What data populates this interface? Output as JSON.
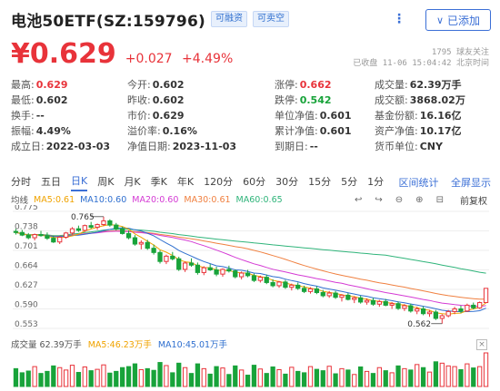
{
  "header": {
    "title": "电池50ETF(SZ:159796)",
    "badges": [
      "可融资",
      "可卖空"
    ],
    "more_icon": "more-dots-icon",
    "added_label": "已添加"
  },
  "quote": {
    "price": "¥0.629",
    "change": "+0.027",
    "change_pct": "+4.49%",
    "followers": "1795 球友关注",
    "status": "已收盘 11-06 15:04:42 北京时间"
  },
  "stats": [
    {
      "label": "最高:",
      "value": "0.629",
      "color": "red"
    },
    {
      "label": "今开:",
      "value": "0.602",
      "color": ""
    },
    {
      "label": "涨停:",
      "value": "0.662",
      "color": "red"
    },
    {
      "label": "成交量:",
      "value": "62.39万手",
      "color": ""
    },
    {
      "label": "最低:",
      "value": "0.602",
      "color": ""
    },
    {
      "label": "昨收:",
      "value": "0.602",
      "color": ""
    },
    {
      "label": "跌停:",
      "value": "0.542",
      "color": "green"
    },
    {
      "label": "成交额:",
      "value": "3868.02万",
      "color": ""
    },
    {
      "label": "换手:",
      "value": "--",
      "color": ""
    },
    {
      "label": "市价:",
      "value": "0.629",
      "color": ""
    },
    {
      "label": "单位净值:",
      "value": "0.601",
      "color": ""
    },
    {
      "label": "基金份额:",
      "value": "16.16亿",
      "color": ""
    },
    {
      "label": "振幅:",
      "value": "4.49%",
      "color": ""
    },
    {
      "label": "溢价率:",
      "value": "0.16%",
      "color": ""
    },
    {
      "label": "累计净值:",
      "value": "0.601",
      "color": ""
    },
    {
      "label": "资产净值:",
      "value": "10.17亿",
      "color": ""
    },
    {
      "label": "成立日:",
      "value": "2022-03-03",
      "color": ""
    },
    {
      "label": "净值日期:",
      "value": "2023-11-03",
      "color": ""
    },
    {
      "label": "到期日:",
      "value": "--",
      "color": ""
    },
    {
      "label": "货币单位:",
      "value": "CNY",
      "color": ""
    }
  ],
  "periods": [
    "分时",
    "五日",
    "日K",
    "周K",
    "月K",
    "季K",
    "年K",
    "120分",
    "60分",
    "30分",
    "15分",
    "5分",
    "1分"
  ],
  "active_period": "日K",
  "period_links": [
    "区间统计",
    "全屏显示"
  ],
  "ma_legend": [
    {
      "label": "均线",
      "color": "#555555"
    },
    {
      "label": "MA5:0.61",
      "color": "#f0a300"
    },
    {
      "label": "MA10:0.60",
      "color": "#2f6fcf"
    },
    {
      "label": "MA20:0.60",
      "color": "#d43ad4"
    },
    {
      "label": "MA30:0.61",
      "color": "#f08040"
    },
    {
      "label": "MA60:0.65",
      "color": "#2fb47a"
    }
  ],
  "chart_tools": [
    "↩",
    "↪",
    "⊖",
    "⊕",
    "⊟"
  ],
  "adjust_label": "前复权",
  "vol_legend": [
    {
      "label": "成交量 62.39万手",
      "color": "#555555"
    },
    {
      "label": "MA5:46.23万手",
      "color": "#f0a300"
    },
    {
      "label": "MA10:45.01万手",
      "color": "#2f6fcf"
    }
  ],
  "vol_close": "×",
  "colors": {
    "up": "#e8333a",
    "down": "#18a33a",
    "accent": "#3b6fd6"
  },
  "chart_data": {
    "type": "candlestick",
    "yticks": [
      "0.775",
      "0.738",
      "0.701",
      "0.664",
      "0.627",
      "0.590",
      "0.553"
    ],
    "ylim": [
      0.553,
      0.775
    ],
    "annotations": [
      {
        "label": "0.765",
        "value": 0.765
      },
      {
        "label": "0.562",
        "value": 0.562
      }
    ],
    "candles": [
      [
        0.737,
        0.742,
        0.731,
        0.735
      ],
      [
        0.735,
        0.74,
        0.728,
        0.73
      ],
      [
        0.73,
        0.734,
        0.722,
        0.725
      ],
      [
        0.725,
        0.733,
        0.72,
        0.731
      ],
      [
        0.731,
        0.738,
        0.727,
        0.729
      ],
      [
        0.729,
        0.735,
        0.721,
        0.724
      ],
      [
        0.724,
        0.729,
        0.715,
        0.717
      ],
      [
        0.717,
        0.728,
        0.713,
        0.726
      ],
      [
        0.726,
        0.736,
        0.723,
        0.734
      ],
      [
        0.734,
        0.745,
        0.731,
        0.742
      ],
      [
        0.742,
        0.748,
        0.736,
        0.739
      ],
      [
        0.739,
        0.75,
        0.736,
        0.748
      ],
      [
        0.748,
        0.755,
        0.742,
        0.745
      ],
      [
        0.745,
        0.752,
        0.74,
        0.75
      ],
      [
        0.75,
        0.765,
        0.747,
        0.757
      ],
      [
        0.757,
        0.76,
        0.746,
        0.749
      ],
      [
        0.749,
        0.753,
        0.739,
        0.742
      ],
      [
        0.742,
        0.746,
        0.731,
        0.733
      ],
      [
        0.733,
        0.739,
        0.722,
        0.725
      ],
      [
        0.725,
        0.73,
        0.71,
        0.713
      ],
      [
        0.713,
        0.72,
        0.703,
        0.716
      ],
      [
        0.716,
        0.721,
        0.702,
        0.705
      ],
      [
        0.705,
        0.712,
        0.693,
        0.697
      ],
      [
        0.697,
        0.701,
        0.676,
        0.68
      ],
      [
        0.68,
        0.693,
        0.675,
        0.69
      ],
      [
        0.69,
        0.698,
        0.682,
        0.685
      ],
      [
        0.685,
        0.689,
        0.662,
        0.665
      ],
      [
        0.665,
        0.68,
        0.66,
        0.677
      ],
      [
        0.677,
        0.686,
        0.67,
        0.673
      ],
      [
        0.673,
        0.678,
        0.655,
        0.659
      ],
      [
        0.659,
        0.671,
        0.654,
        0.668
      ],
      [
        0.668,
        0.675,
        0.662,
        0.664
      ],
      [
        0.664,
        0.67,
        0.652,
        0.656
      ],
      [
        0.656,
        0.667,
        0.651,
        0.665
      ],
      [
        0.665,
        0.672,
        0.659,
        0.662
      ],
      [
        0.662,
        0.665,
        0.648,
        0.651
      ],
      [
        0.651,
        0.661,
        0.646,
        0.658
      ],
      [
        0.658,
        0.664,
        0.65,
        0.653
      ],
      [
        0.653,
        0.657,
        0.641,
        0.644
      ],
      [
        0.644,
        0.653,
        0.64,
        0.65
      ],
      [
        0.65,
        0.655,
        0.637,
        0.64
      ],
      [
        0.64,
        0.646,
        0.631,
        0.634
      ],
      [
        0.634,
        0.643,
        0.63,
        0.641
      ],
      [
        0.641,
        0.645,
        0.628,
        0.631
      ],
      [
        0.631,
        0.638,
        0.625,
        0.635
      ],
      [
        0.635,
        0.64,
        0.626,
        0.629
      ],
      [
        0.629,
        0.634,
        0.62,
        0.623
      ],
      [
        0.623,
        0.631,
        0.619,
        0.628
      ],
      [
        0.628,
        0.633,
        0.618,
        0.621
      ],
      [
        0.621,
        0.626,
        0.612,
        0.615
      ],
      [
        0.615,
        0.624,
        0.611,
        0.62
      ],
      [
        0.62,
        0.624,
        0.609,
        0.612
      ],
      [
        0.612,
        0.618,
        0.604,
        0.616
      ],
      [
        0.616,
        0.62,
        0.606,
        0.608
      ],
      [
        0.608,
        0.614,
        0.601,
        0.611
      ],
      [
        0.611,
        0.615,
        0.6,
        0.603
      ],
      [
        0.603,
        0.61,
        0.598,
        0.606
      ],
      [
        0.606,
        0.611,
        0.596,
        0.599
      ],
      [
        0.599,
        0.607,
        0.594,
        0.604
      ],
      [
        0.604,
        0.609,
        0.595,
        0.597
      ],
      [
        0.597,
        0.603,
        0.59,
        0.6
      ],
      [
        0.6,
        0.604,
        0.588,
        0.591
      ],
      [
        0.591,
        0.599,
        0.586,
        0.596
      ],
      [
        0.596,
        0.6,
        0.583,
        0.586
      ],
      [
        0.586,
        0.594,
        0.58,
        0.59
      ],
      [
        0.59,
        0.595,
        0.578,
        0.581
      ],
      [
        0.581,
        0.588,
        0.575,
        0.584
      ],
      [
        0.584,
        0.588,
        0.569,
        0.572
      ],
      [
        0.572,
        0.58,
        0.562,
        0.577
      ],
      [
        0.577,
        0.588,
        0.574,
        0.585
      ],
      [
        0.585,
        0.594,
        0.58,
        0.59
      ],
      [
        0.59,
        0.596,
        0.582,
        0.586
      ],
      [
        0.586,
        0.6,
        0.584,
        0.597
      ],
      [
        0.597,
        0.602,
        0.589,
        0.592
      ],
      [
        0.592,
        0.604,
        0.59,
        0.602
      ],
      [
        0.602,
        0.629,
        0.602,
        0.629
      ]
    ],
    "volume": [
      52,
      40,
      45,
      58,
      38,
      44,
      60,
      55,
      48,
      62,
      41,
      57,
      46,
      50,
      63,
      39,
      44,
      55,
      58,
      66,
      49,
      52,
      47,
      70,
      61,
      40,
      68,
      55,
      38,
      66,
      52,
      36,
      58,
      54,
      35,
      60,
      48,
      33,
      62,
      51,
      38,
      57,
      49,
      36,
      56,
      44,
      40,
      58,
      50,
      46,
      59,
      37,
      52,
      48,
      35,
      57,
      44,
      38,
      55,
      46,
      40,
      60,
      52,
      48,
      64,
      55,
      42,
      72,
      68,
      60,
      58,
      49,
      66,
      54,
      58,
      98
    ]
  }
}
